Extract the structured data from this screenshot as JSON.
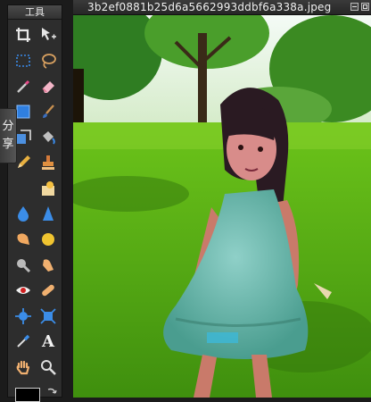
{
  "tools_panel": {
    "title": "工具",
    "tools": [
      {
        "name": "crop-tool-icon",
        "label": "Crop"
      },
      {
        "name": "move-tool-icon",
        "label": "Move"
      },
      {
        "name": "marquee-tool-icon",
        "label": "Marquee"
      },
      {
        "name": "lasso-tool-icon",
        "label": "Lasso"
      },
      {
        "name": "wand-tool-icon",
        "label": "Magic Wand"
      },
      {
        "name": "eraser-tool-icon",
        "label": "Eraser"
      },
      {
        "name": "rectangle-tool-icon",
        "label": "Shape"
      },
      {
        "name": "brush-tool-icon",
        "label": "Brush"
      },
      {
        "name": "clone-tool-icon",
        "label": "Clone"
      },
      {
        "name": "bucket-tool-icon",
        "label": "Paint Bucket"
      },
      {
        "name": "pencil-tool-icon",
        "label": "Pencil"
      },
      {
        "name": "stamp-tool-icon",
        "label": "Stamp"
      },
      {
        "name": "empty-slot",
        "label": ""
      },
      {
        "name": "smudge-tool-icon",
        "label": "Smudge"
      },
      {
        "name": "blur-tool-icon",
        "label": "Blur"
      },
      {
        "name": "sharpen-tool-icon",
        "label": "Sharpen"
      },
      {
        "name": "dodge-tool-icon",
        "label": "Dodge"
      },
      {
        "name": "sponge-tool-icon",
        "label": "Sponge"
      },
      {
        "name": "burn-tool-icon",
        "label": "Burn"
      },
      {
        "name": "finger-tool-icon",
        "label": "Finger"
      },
      {
        "name": "red-eye-tool-icon",
        "label": "Red Eye"
      },
      {
        "name": "bandage-tool-icon",
        "label": "Heal"
      },
      {
        "name": "bloat-tool-icon",
        "label": "Bloat"
      },
      {
        "name": "pinch-tool-icon",
        "label": "Pinch"
      },
      {
        "name": "eyedropper-tool-icon",
        "label": "Eyedropper"
      },
      {
        "name": "text-tool-icon",
        "label": "A"
      },
      {
        "name": "hand-tool-icon",
        "label": "Hand"
      },
      {
        "name": "zoom-tool-icon",
        "label": "Zoom"
      }
    ],
    "foreground_color": "#000000"
  },
  "share_tab": {
    "chars": [
      "分",
      "享"
    ]
  },
  "image_window": {
    "title": "3b2ef0881b25d6a5662993ddbf6a338a.jpeg"
  },
  "colors": {
    "panel_bg": "#2d2d2d",
    "accent_blue": "#2f7fe0",
    "grass": "#5fb313"
  }
}
